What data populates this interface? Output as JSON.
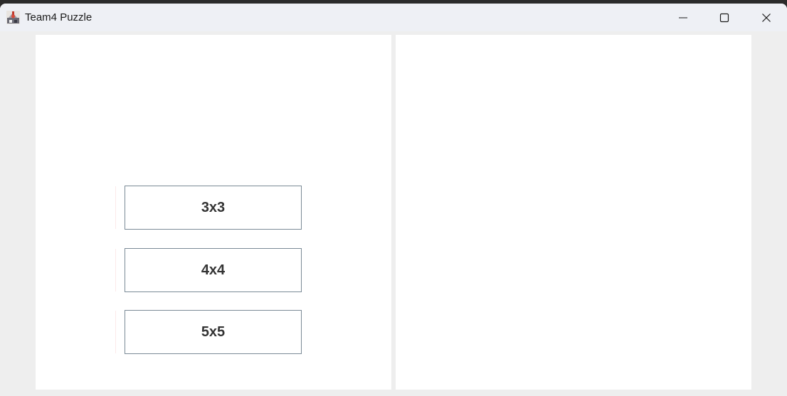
{
  "window": {
    "title": "Team4 Puzzle",
    "icon": "java-app-icon",
    "controls": {
      "minimize_icon": "minimize-icon",
      "maximize_icon": "maximize-icon",
      "close_icon": "close-icon"
    }
  },
  "left_panel": {
    "buttons": [
      {
        "label": "3x3"
      },
      {
        "label": "4x4"
      },
      {
        "label": "5x5"
      }
    ]
  },
  "right_panel": {},
  "colors": {
    "titlebar_bg": "#eef0f5",
    "window_bg": "#eeeeee",
    "panel_bg": "#ffffff",
    "button_border": "#7a8a96",
    "button_text": "#333333"
  }
}
